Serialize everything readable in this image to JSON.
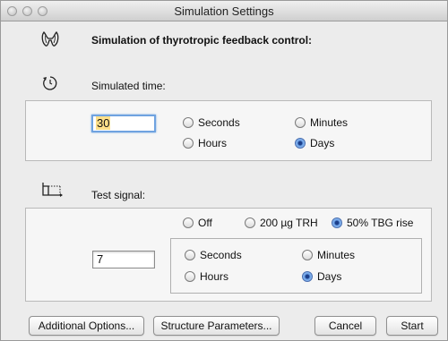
{
  "window": {
    "title": "Simulation Settings"
  },
  "header": {
    "heading": "Simulation of thyrotropic feedback control:"
  },
  "sim_time": {
    "label": "Simulated time:",
    "value": "30",
    "units": [
      {
        "label": "Seconds",
        "selected": false
      },
      {
        "label": "Minutes",
        "selected": false
      },
      {
        "label": "Hours",
        "selected": false
      },
      {
        "label": "Days",
        "selected": true
      }
    ]
  },
  "test_signal": {
    "label": "Test signal:",
    "signals": [
      {
        "label": "Off",
        "selected": false
      },
      {
        "label": "200 µg TRH",
        "selected": false
      },
      {
        "label": "50% TBG rise",
        "selected": true
      }
    ],
    "value": "7",
    "units": [
      {
        "label": "Seconds",
        "selected": false
      },
      {
        "label": "Minutes",
        "selected": false
      },
      {
        "label": "Hours",
        "selected": false
      },
      {
        "label": "Days",
        "selected": true
      }
    ]
  },
  "buttons": {
    "additional": "Additional Options...",
    "structure": "Structure Parameters...",
    "cancel": "Cancel",
    "start": "Start"
  },
  "icons": {
    "thyroid": "thyroid-gland-icon",
    "clock": "clock-icon",
    "signal": "step-signal-icon"
  },
  "colors": {
    "focus": "#6fa3e0",
    "selection": "#ffe08a",
    "radio_on": "#4a6fb0"
  }
}
